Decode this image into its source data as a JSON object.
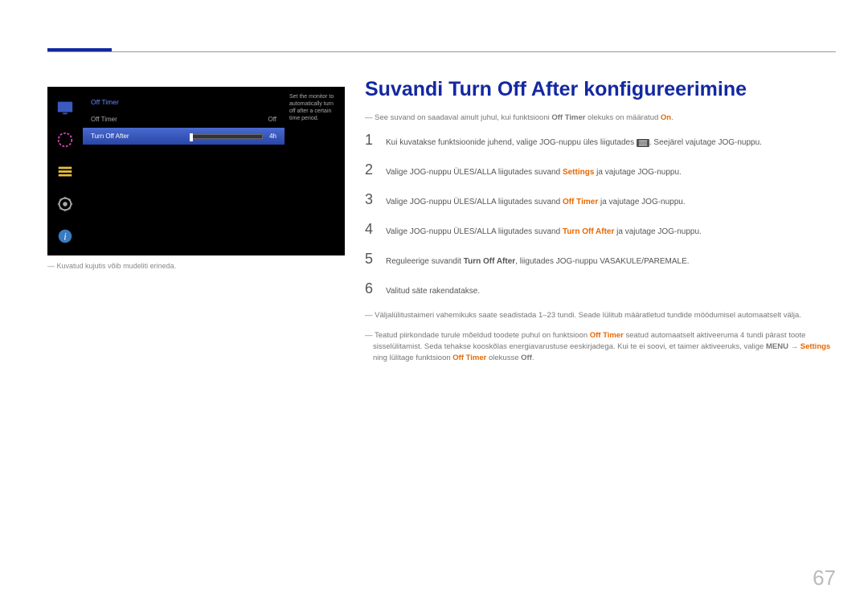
{
  "menu": {
    "header": "Off Timer",
    "items": [
      {
        "label": "Off Timer",
        "value": "Off"
      },
      {
        "label": "Turn Off After",
        "value": "4h"
      }
    ],
    "desc": "Set the monitor to automatically turn off after a certain time period."
  },
  "caption": "Kuvatud kujutis võib mudeliti erineda.",
  "title": "Suvandi Turn Off After konfigureerimine",
  "note1_a": "See suvand on saadaval ainult juhul, kui funktsiooni ",
  "note1_b": "Off Timer",
  "note1_c": " olekuks on määratud ",
  "note1_d": "On",
  "note1_e": ".",
  "steps": {
    "s1_a": "Kui kuvatakse funktsioonide juhend, valige JOG-nuppu üles liigutades ",
    "s1_b": ". Seejärel vajutage JOG-nuppu.",
    "s2_a": "Valige JOG-nuppu ÜLES/ALLA liigutades suvand ",
    "s2_b": "Settings",
    "s2_c": " ja vajutage JOG-nuppu.",
    "s3_a": "Valige JOG-nuppu ÜLES/ALLA liigutades suvand ",
    "s3_b": "Off Timer",
    "s3_c": " ja vajutage JOG-nuppu.",
    "s4_a": "Valige JOG-nuppu ÜLES/ALLA liigutades suvand ",
    "s4_b": "Turn Off After",
    "s4_c": " ja vajutage JOG-nuppu.",
    "s5_a": "Reguleerige suvandit ",
    "s5_b": "Turn Off After",
    "s5_c": ", liigutades JOG-nuppu VASAKULE/PAREMALE.",
    "s6": "Valitud säte rakendatakse."
  },
  "note2": "Väljalülitustaimeri vahemikuks saate seadistada 1–23 tundi. Seade lülitub määratletud tundide möödumisel automaatselt välja.",
  "note3_a": "Teatud piirkondade turule mõeldud toodete puhul on funktsioon ",
  "note3_b": "Off Timer",
  "note3_c": "  seatud automaatselt aktiveeruma 4 tundi pärast toote sisselülitamist. Seda tehakse kooskõlas energiavarustuse eeskirjadega. Kui te ei soovi, et taimer aktiveeruks, valige ",
  "note3_d": "MENU",
  "note3_arrow": " → ",
  "note3_e": "Settings",
  "note3_f": " ning lülitage funktsioon ",
  "note3_g": "Off Timer",
  "note3_h": " olekusse ",
  "note3_i": "Off",
  "note3_j": ".",
  "pageNum": "67"
}
